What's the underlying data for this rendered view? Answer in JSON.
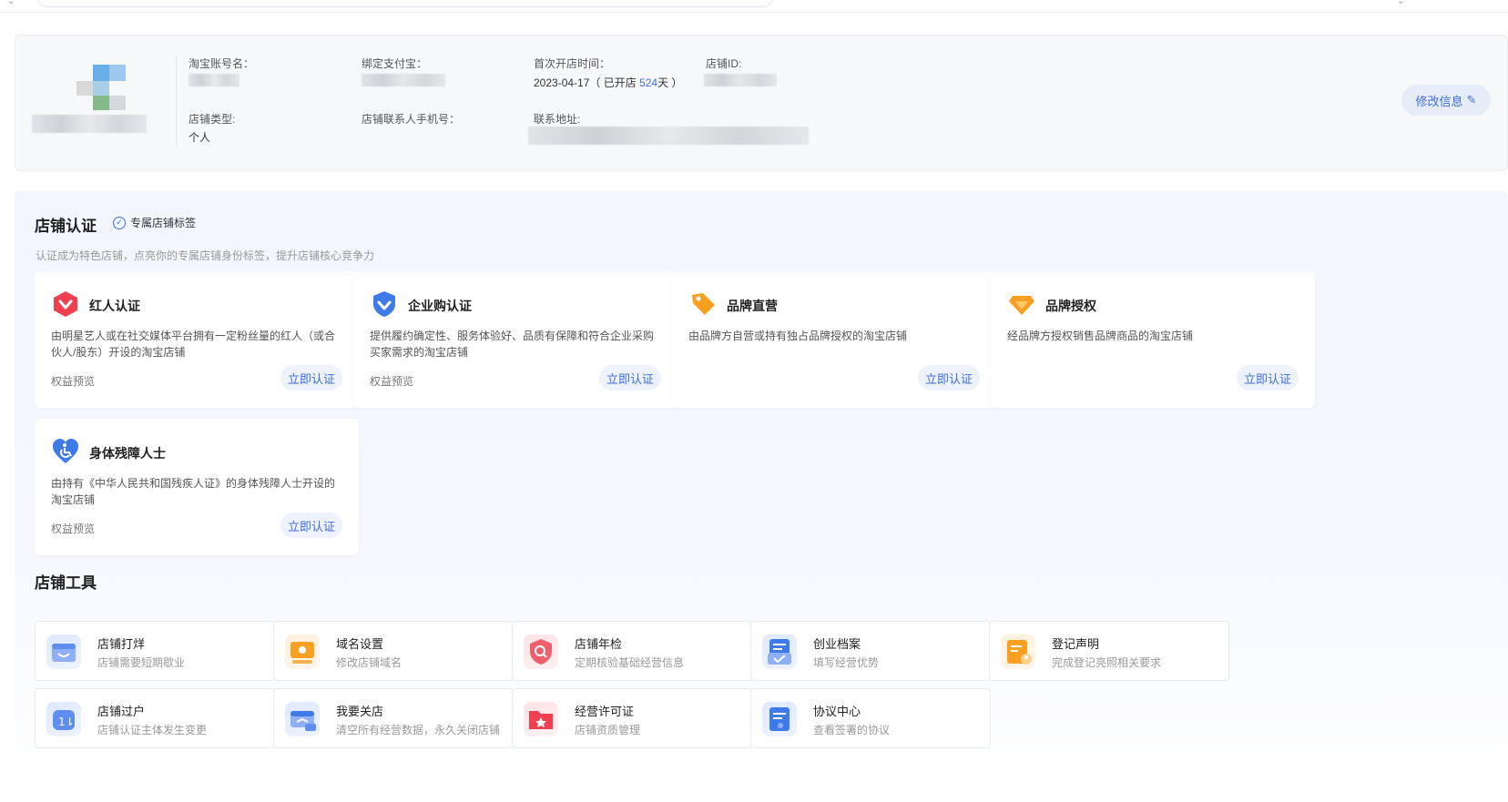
{
  "profile": {
    "taobao_account_label": "淘宝账号名：",
    "alipay_label": "绑定支付宝：",
    "open_time_label": "首次开店时间：",
    "open_date": "2023-04-17",
    "open_prefix": "（ 已开店 ",
    "open_days": "524",
    "open_suffix": "天 ）",
    "shop_id_label": "店铺ID:",
    "shop_type_label": "店铺类型:",
    "shop_type_value": "个人",
    "phone_label": "店铺联系人手机号：",
    "address_label": "联系地址:",
    "edit_button": "修改信息"
  },
  "cert": {
    "title": "店铺认证",
    "tag_link": "专属店铺标签",
    "subtitle": "认证成为特色店铺，点亮你的专属店铺身份标签，提升店铺核心竞争力",
    "cards": [
      {
        "title": "红人认证",
        "desc": "由明星艺人或在社交媒体平台拥有一定粉丝量的红人（或合伙人/股东）开设的淘宝店铺",
        "preview": "权益预览",
        "action": "立即认证",
        "icon": "red-hexagon-v-icon"
      },
      {
        "title": "企业购认证",
        "desc": "提供履约确定性、服务体验好、品质有保障和符合企业采购买家需求的淘宝店铺",
        "preview": "权益预览",
        "action": "立即认证",
        "icon": "blue-shield-v-icon"
      },
      {
        "title": "品牌直营",
        "desc": "由品牌方自营或持有独占品牌授权的淘宝店铺",
        "preview": "",
        "action": "立即认证",
        "icon": "orange-tag-icon"
      },
      {
        "title": "品牌授权",
        "desc": "经品牌方授权销售品牌商品的淘宝店铺",
        "preview": "",
        "action": "立即认证",
        "icon": "orange-diamond-icon"
      },
      {
        "title": "身体残障人士",
        "desc": "由持有《中华人民共和国残疾人证》的身体残障人士开设的淘宝店铺",
        "preview": "权益预览",
        "action": "立即认证",
        "icon": "blue-heart-wheelchair-icon"
      }
    ]
  },
  "tools": {
    "title": "店铺工具",
    "items": [
      {
        "name": "店铺打烊",
        "desc": "店铺需要短期歇业",
        "icon": "shop-close-icon"
      },
      {
        "name": "域名设置",
        "desc": "修改店铺域名",
        "icon": "domain-setting-icon"
      },
      {
        "name": "店铺年检",
        "desc": "定期核验基础经营信息",
        "icon": "annual-check-shield-icon"
      },
      {
        "name": "创业档案",
        "desc": "填写经营优势",
        "icon": "startup-profile-icon"
      },
      {
        "name": "登记声明",
        "desc": "完成登记亮照相关要求",
        "icon": "registration-statement-icon"
      },
      {
        "name": "店铺过户",
        "desc": "店铺认证主体发生变更",
        "icon": "shop-transfer-icon"
      },
      {
        "name": "我要关店",
        "desc": "清空所有经营数据，永久关闭店铺",
        "icon": "close-shop-icon"
      },
      {
        "name": "经营许可证",
        "desc": "店铺资质管理",
        "icon": "business-license-icon"
      },
      {
        "name": "协议中心",
        "desc": "查看签署的协议",
        "icon": "agreement-center-icon"
      }
    ]
  },
  "colors": {
    "accent": "#3d6de0",
    "red": "#f0404f",
    "orange": "#f7a021",
    "blue": "#3f7be8"
  }
}
